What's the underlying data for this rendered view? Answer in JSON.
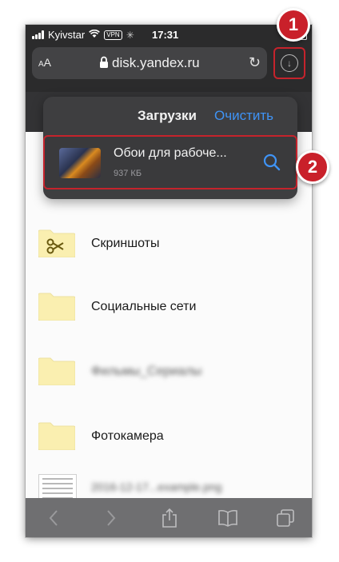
{
  "status_bar": {
    "carrier": "Kyivstar",
    "vpn_label": "VPN",
    "time": "17:31"
  },
  "address_bar": {
    "text_size_label_small": "A",
    "text_size_label_large": "A",
    "url": "disk.yandex.ru",
    "icons": [
      "lock-icon",
      "reload-icon",
      "download-icon"
    ]
  },
  "downloads_popover": {
    "title": "Загрузки",
    "clear_label": "Очистить",
    "items": [
      {
        "name": "Обои для рабоче...",
        "size": "937 КБ"
      }
    ]
  },
  "file_list": [
    {
      "name": "Скриншоты",
      "icon": "folder-scissors-icon",
      "blurred": false
    },
    {
      "name": "Социальные сети",
      "icon": "folder-icon",
      "blurred": false
    },
    {
      "name": "Фильмы_Сериалы",
      "icon": "folder-icon",
      "blurred": true
    },
    {
      "name": "Фотокамера",
      "icon": "folder-icon",
      "blurred": false
    },
    {
      "name": "2016-12-17...example.png",
      "icon": "document-thumbnail",
      "blurred": true
    }
  ],
  "callouts": [
    "1",
    "2"
  ],
  "toolbar": {
    "buttons": [
      "back-icon",
      "forward-icon",
      "share-icon",
      "bookmarks-icon",
      "tabs-icon"
    ]
  },
  "colors": {
    "accent_blue": "#3f93f5",
    "callout_red": "#c9202a",
    "folder_yellow": "#faefb0"
  }
}
